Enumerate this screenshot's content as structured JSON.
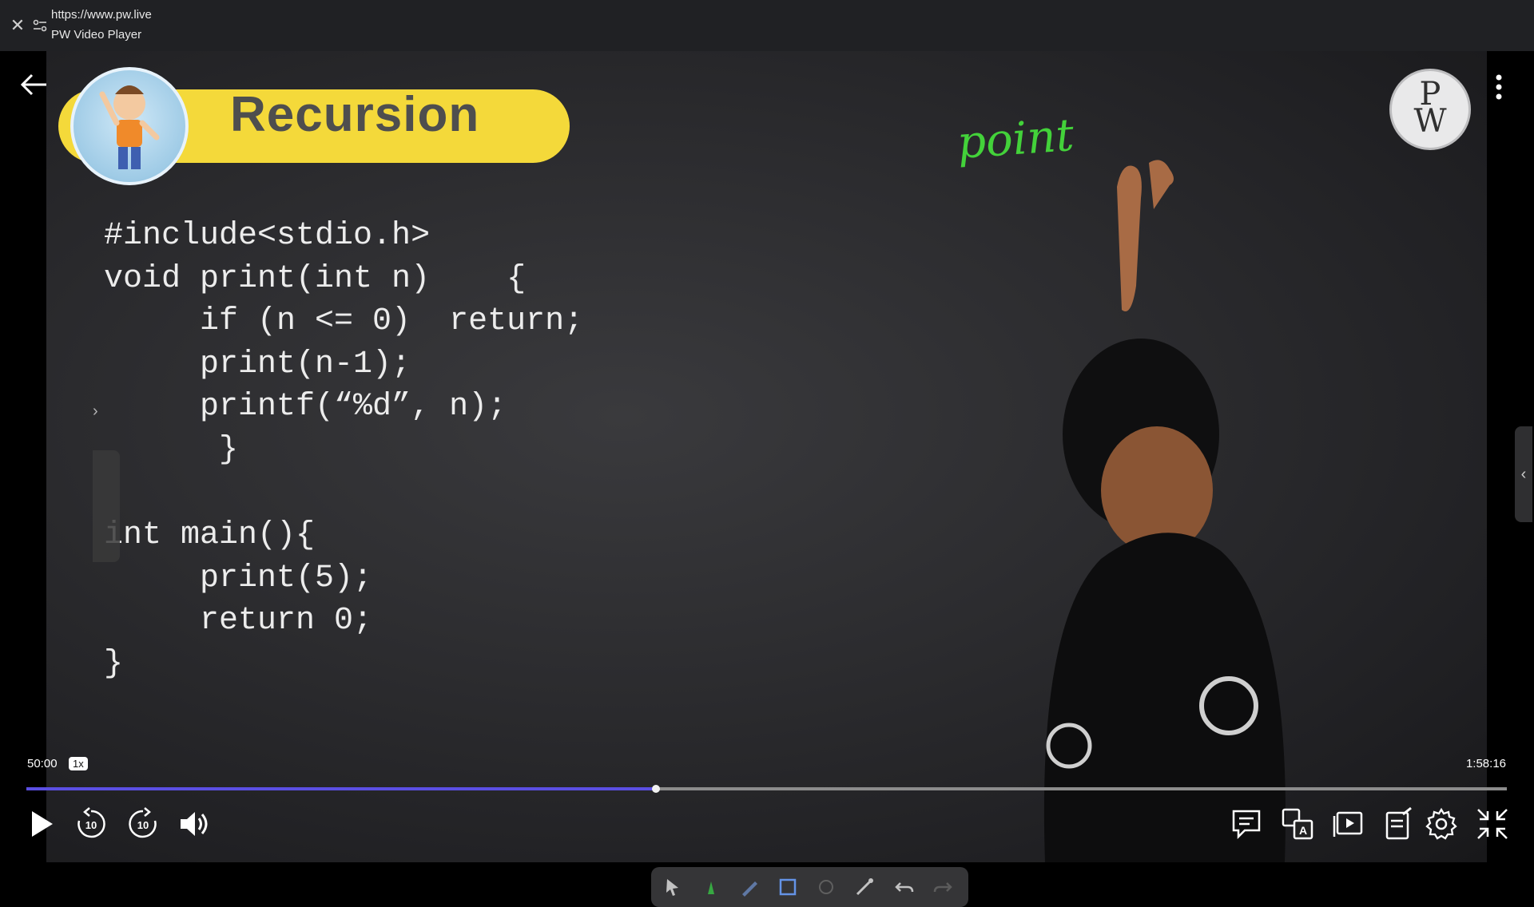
{
  "browser": {
    "url": "https://www.pw.live",
    "title": "PW Video Player"
  },
  "slide": {
    "banner_title": "Recursion",
    "code_lines": [
      "#include<stdio.h>",
      "void print(int n)    {",
      "     if (n <= 0)  return;",
      "     print(n-1);",
      "     printf(“%d”, n);",
      "      }",
      "",
      "int main(){",
      "     print(5);",
      "     return 0;",
      "}"
    ],
    "handwriting": "point",
    "logo_top": "P",
    "logo_bottom": "W"
  },
  "player": {
    "current_time": "50:00",
    "speed": "1x",
    "total_time": "1:58:16",
    "progress_fraction": 0.4255,
    "skip_back_seconds": "10",
    "skip_forward_seconds": "10"
  },
  "colors": {
    "progress": "#5b4fe3",
    "banner": "#f4d93a",
    "handwriting": "#43d23a"
  }
}
